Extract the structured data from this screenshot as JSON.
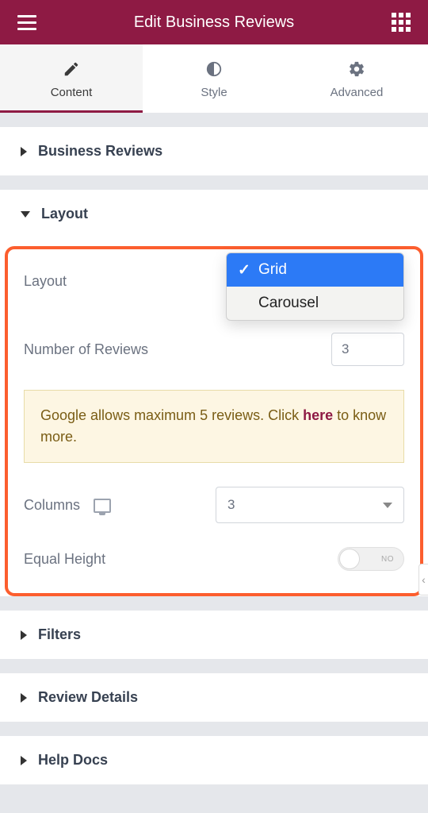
{
  "header": {
    "title": "Edit Business Reviews"
  },
  "tabs": {
    "content": "Content",
    "style": "Style",
    "advanced": "Advanced"
  },
  "sections": {
    "business_reviews": "Business Reviews",
    "layout": "Layout",
    "filters": "Filters",
    "review_details": "Review Details",
    "help_docs": "Help Docs"
  },
  "layout": {
    "layout_label": "Layout",
    "layout_options": {
      "grid": "Grid",
      "carousel": "Carousel"
    },
    "num_reviews_label": "Number of Reviews",
    "num_reviews_value": "3",
    "notice_pre": "Google allows maximum 5 reviews. Click ",
    "notice_link": "here",
    "notice_post": " to know more.",
    "columns_label": "Columns",
    "columns_value": "3",
    "equal_height_label": "Equal Height",
    "equal_height_value": "NO"
  }
}
